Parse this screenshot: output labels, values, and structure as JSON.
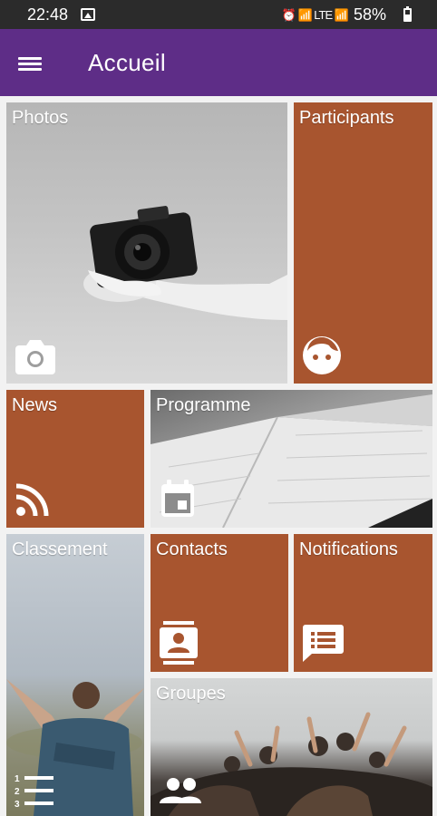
{
  "status_bar": {
    "time": "22:48",
    "system_icons": "⏰ 📶 LTE 📶",
    "battery_percent": "58%",
    "battery_level": 0.58
  },
  "app_bar": {
    "title": "Accueil",
    "color": "#5e2d87"
  },
  "tiles": {
    "photos": {
      "label": "Photos",
      "icon": "camera-icon"
    },
    "participants": {
      "label": "Participants",
      "icon": "face-icon"
    },
    "news": {
      "label": "News",
      "icon": "rss-icon"
    },
    "programme": {
      "label": "Programme",
      "icon": "calendar-icon"
    },
    "classement": {
      "label": "Classement",
      "icon": "ranking-list-icon"
    },
    "contacts": {
      "label": "Contacts",
      "icon": "contact-card-icon"
    },
    "notifications": {
      "label": "Notifications",
      "icon": "message-icon"
    },
    "groupes": {
      "label": "Groupes",
      "icon": "group-icon"
    }
  },
  "colors": {
    "tile_accent": "#a8552f",
    "background": "#f2f2f2",
    "status_bar": "#2b2b2b"
  }
}
